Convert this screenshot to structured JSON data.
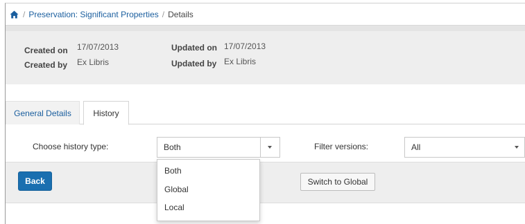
{
  "breadcrumb": {
    "home_icon": "home-icon",
    "items": [
      "Preservation: Significant Properties",
      "Details"
    ],
    "separator": "/"
  },
  "record_info": {
    "created_on_label": "Created on",
    "created_on_value": "17/07/2013",
    "created_by_label": "Created by",
    "created_by_value": "Ex Libris",
    "updated_on_label": "Updated on",
    "updated_on_value": "17/07/2013",
    "updated_by_label": "Updated by",
    "updated_by_value": "Ex Libris"
  },
  "tabs": [
    {
      "label": "General Details",
      "active": false
    },
    {
      "label": "History",
      "active": true
    }
  ],
  "filters": {
    "history_type_label": "Choose history type:",
    "history_type_value": "Both",
    "history_type_options": [
      "Both",
      "Global",
      "Local"
    ],
    "filter_versions_label": "Filter versions:",
    "filter_versions_value": "All"
  },
  "actions": {
    "back_label": "Back",
    "switch_label": "Switch to Global"
  },
  "colors": {
    "primary": "#1a6fb0",
    "link": "#1a5e9e",
    "panel_bg": "#eeeeee"
  }
}
